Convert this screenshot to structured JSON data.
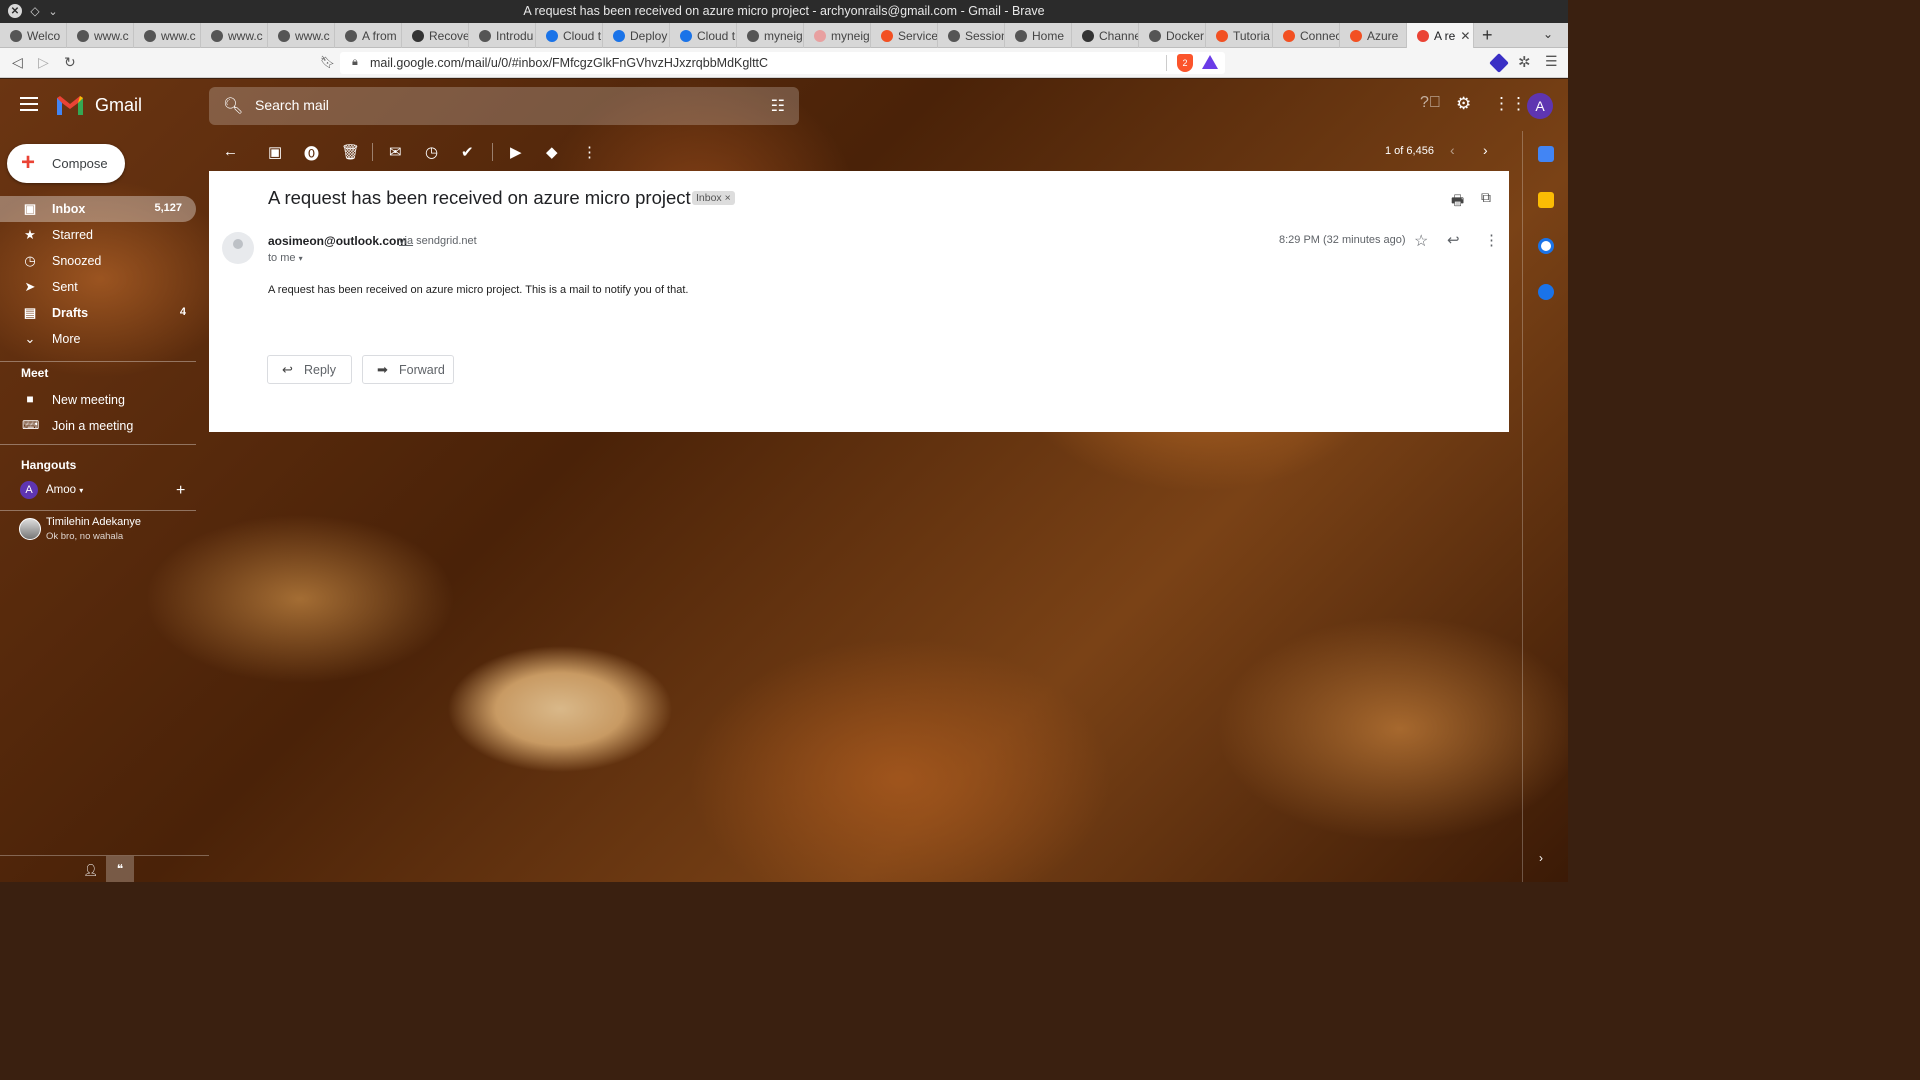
{
  "window": {
    "title": "A request has been received on azure micro project - archyonrails@gmail.com - Gmail - Brave"
  },
  "tabs": [
    {
      "label": "Welco",
      "color": "#555"
    },
    {
      "label": "www.c",
      "color": "#555"
    },
    {
      "label": "www.c",
      "color": "#555"
    },
    {
      "label": "www.c",
      "color": "#555"
    },
    {
      "label": "www.c",
      "color": "#555"
    },
    {
      "label": "A from",
      "color": "#555"
    },
    {
      "label": "Recove",
      "color": "#333"
    },
    {
      "label": "Introdu",
      "color": "#555"
    },
    {
      "label": "Cloud t",
      "color": "#1a73e8"
    },
    {
      "label": "Deploy",
      "color": "#1a73e8"
    },
    {
      "label": "Cloud t",
      "color": "#1a73e8"
    },
    {
      "label": "myneig",
      "color": "#555"
    },
    {
      "label": "myneig",
      "color": "#e8a0a0"
    },
    {
      "label": "Service",
      "color": "#f25022"
    },
    {
      "label": "Session",
      "color": "#555"
    },
    {
      "label": "Home",
      "color": "#555"
    },
    {
      "label": "Channe",
      "color": "#333"
    },
    {
      "label": "Docker",
      "color": "#555"
    },
    {
      "label": "Tutoria",
      "color": "#f25022"
    },
    {
      "label": "Connec",
      "color": "#f25022"
    },
    {
      "label": "Azure",
      "color": "#f25022"
    },
    {
      "label": "A re",
      "color": "#ea4335",
      "active": true
    }
  ],
  "address": {
    "url": "mail.google.com/mail/u/0/#inbox/FMfcgzGlkFnGVhvzHJxzrqbbMdKglttC"
  },
  "gmail": {
    "brand": "Gmail",
    "search_placeholder": "Search mail",
    "account_initial": "A",
    "compose_label": "Compose",
    "nav": [
      {
        "label": "Inbox",
        "count": "5,127",
        "icon": "inbox-icon",
        "glyph": "▣",
        "active": true
      },
      {
        "label": "Starred",
        "count": "",
        "icon": "star-icon",
        "glyph": "★"
      },
      {
        "label": "Snoozed",
        "count": "",
        "icon": "clock-icon",
        "glyph": "◷"
      },
      {
        "label": "Sent",
        "count": "",
        "icon": "send-icon",
        "glyph": "➤"
      },
      {
        "label": "Drafts",
        "count": "4",
        "icon": "draft-icon",
        "glyph": "▤",
        "bold": true
      },
      {
        "label": "More",
        "count": "",
        "icon": "chevron-down-icon",
        "glyph": "⌄"
      }
    ],
    "meet": {
      "heading": "Meet",
      "new_meeting": "New meeting",
      "join_meeting": "Join a meeting"
    },
    "hangouts": {
      "heading": "Hangouts",
      "me_initial": "A",
      "me_name": "Amoo",
      "contact_name": "Timilehin Adekanye",
      "contact_message": "Ok bro, no wahala"
    },
    "pager": "1 of 6,456",
    "email": {
      "subject": "A request has been received on azure micro project",
      "label": "Inbox",
      "sender": "aosimeon@outlook.com",
      "via_word": "via",
      "via_domain": "sendgrid.net",
      "to": "to me",
      "time": "8:29 PM (32 minutes ago)",
      "body": "A request has been received on azure micro project. This is a mail to notify you of that.",
      "reply_label": "Reply",
      "forward_label": "Forward"
    }
  }
}
